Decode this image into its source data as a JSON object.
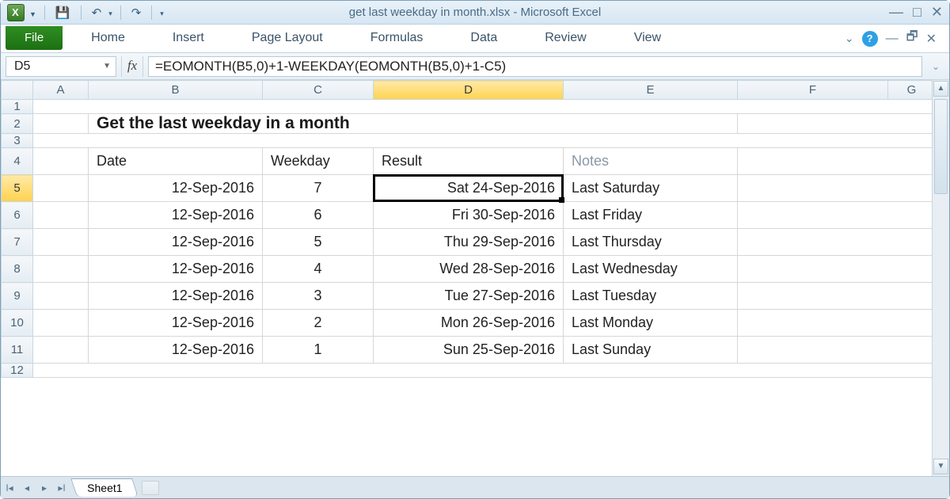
{
  "window": {
    "title": "get last weekday in month.xlsx  -  Microsoft Excel"
  },
  "qat": {
    "save": "💾",
    "undo": "↶",
    "redo": "↷"
  },
  "tabs": {
    "file": "File",
    "home": "Home",
    "insert": "Insert",
    "page_layout": "Page Layout",
    "formulas": "Formulas",
    "data": "Data",
    "review": "Review",
    "view": "View"
  },
  "name_box": "D5",
  "fx_label": "fx",
  "formula": "=EOMONTH(B5,0)+1-WEEKDAY(EOMONTH(B5,0)+1-C5)",
  "columns": [
    "A",
    "B",
    "C",
    "D",
    "E",
    "F",
    "G"
  ],
  "selected_column": "D",
  "rows": [
    1,
    2,
    3,
    4,
    5,
    6,
    7,
    8,
    9,
    10,
    11,
    12
  ],
  "selected_row": 5,
  "content_title": "Get the last weekday in a month",
  "headers": {
    "date": "Date",
    "weekday": "Weekday",
    "result": "Result",
    "notes": "Notes"
  },
  "data_rows": [
    {
      "date": "12-Sep-2016",
      "weekday": "7",
      "result": "Sat 24-Sep-2016",
      "notes": "Last Saturday"
    },
    {
      "date": "12-Sep-2016",
      "weekday": "6",
      "result": "Fri 30-Sep-2016",
      "notes": "Last Friday"
    },
    {
      "date": "12-Sep-2016",
      "weekday": "5",
      "result": "Thu 29-Sep-2016",
      "notes": "Last Thursday"
    },
    {
      "date": "12-Sep-2016",
      "weekday": "4",
      "result": "Wed 28-Sep-2016",
      "notes": "Last Wednesday"
    },
    {
      "date": "12-Sep-2016",
      "weekday": "3",
      "result": "Tue 27-Sep-2016",
      "notes": "Last Tuesday"
    },
    {
      "date": "12-Sep-2016",
      "weekday": "2",
      "result": "Mon 26-Sep-2016",
      "notes": "Last Monday"
    },
    {
      "date": "12-Sep-2016",
      "weekday": "1",
      "result": "Sun 25-Sep-2016",
      "notes": "Last Sunday"
    }
  ],
  "sheet_name": "Sheet1"
}
